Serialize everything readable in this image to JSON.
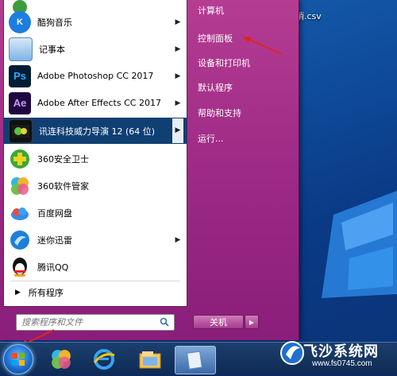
{
  "desktop": {
    "file_label": "销.csv"
  },
  "programs": [
    {
      "label": "酷狗音乐",
      "icon": "kugou-icon",
      "has_submenu": true
    },
    {
      "label": "记事本",
      "icon": "notepad-icon",
      "has_submenu": true
    },
    {
      "label": "Adobe Photoshop CC 2017",
      "icon": "photoshop-icon",
      "icon_text": "Ps",
      "has_submenu": true
    },
    {
      "label": "Adobe After Effects CC 2017",
      "icon": "after-effects-icon",
      "icon_text": "Ae",
      "has_submenu": true
    },
    {
      "label": "讯连科技威力导演 12 (64 位)",
      "icon": "powerdirector-icon",
      "has_submenu": true,
      "selected": true
    },
    {
      "label": "360安全卫士",
      "icon": "360-safe-icon",
      "has_submenu": false
    },
    {
      "label": "360软件管家",
      "icon": "360-software-icon",
      "has_submenu": false
    },
    {
      "label": "百度网盘",
      "icon": "baidu-netdisk-icon",
      "has_submenu": false
    },
    {
      "label": "迷你迅雷",
      "icon": "xunlei-icon",
      "has_submenu": true
    },
    {
      "label": "腾讯QQ",
      "icon": "qq-icon",
      "has_submenu": false
    }
  ],
  "all_programs": "所有程序",
  "search": {
    "placeholder": "搜索程序和文件"
  },
  "right_pane": [
    "计算机",
    "控制面板",
    "设备和打印机",
    "默认程序",
    "帮助和支持",
    "运行..."
  ],
  "shutdown_label": "关机",
  "watermark": {
    "title": "飞沙系统网",
    "url": "www.fs0745.com"
  },
  "colors": {
    "menu_accent": "#9d2a86",
    "selected": "#0f3f73",
    "annotation": "#e02424"
  }
}
